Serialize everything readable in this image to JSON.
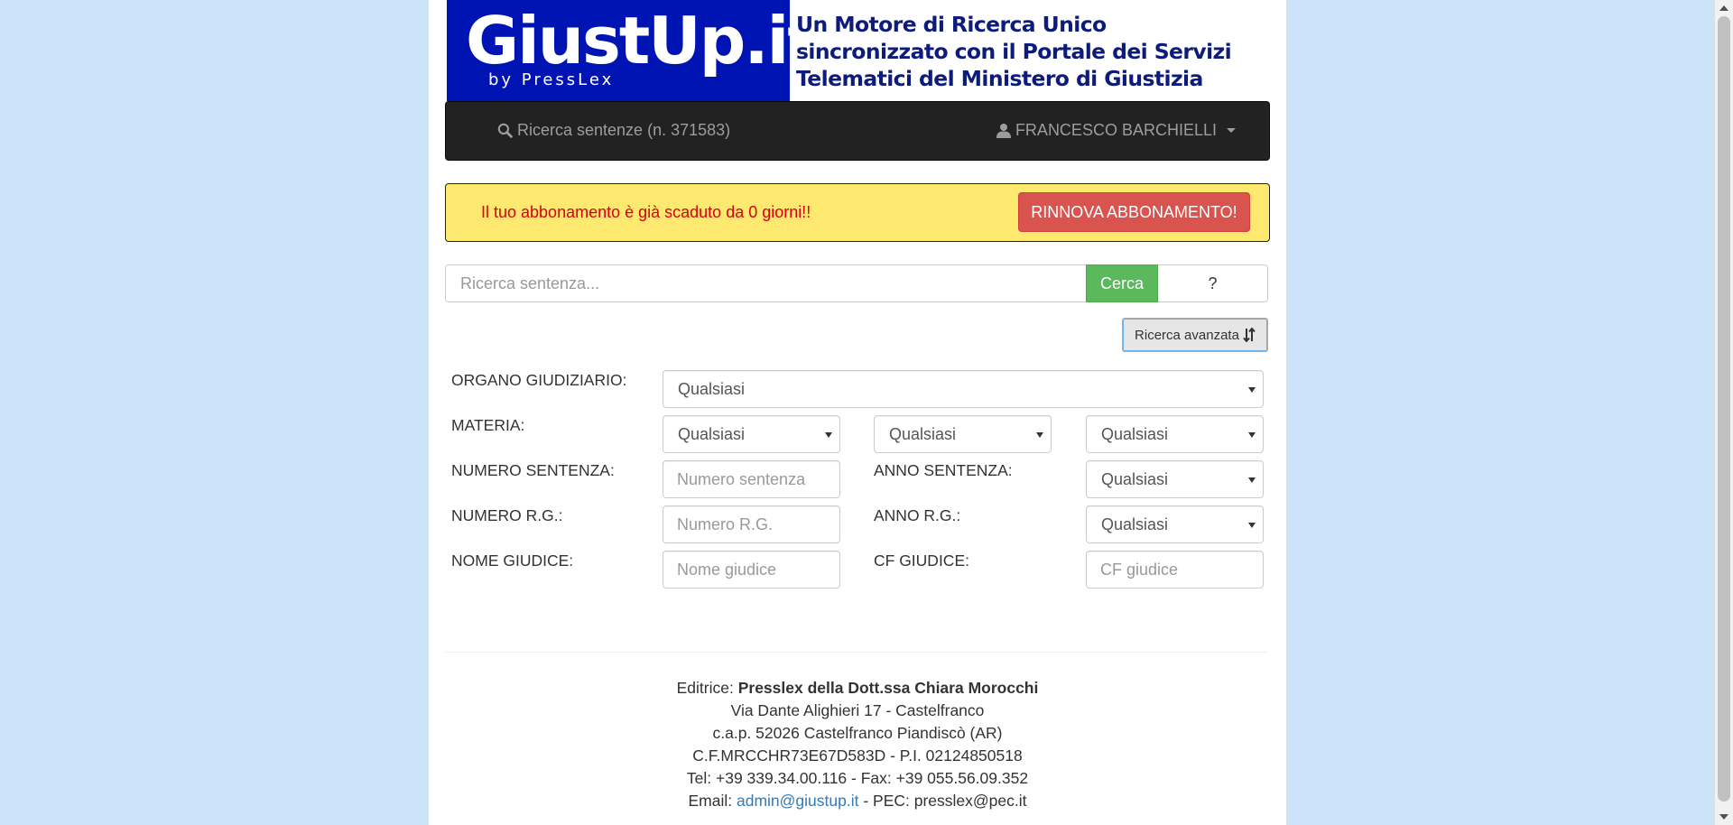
{
  "banner": {
    "logo_title": "GiustUp.it",
    "logo_sub": "by PressLex",
    "tagline": [
      "Un Motore di Ricerca Unico",
      "sincronizzato con il Portale dei Servizi",
      "Telematici del Ministero di Giustizia"
    ]
  },
  "navbar": {
    "search_label": "Ricerca sentenze (n. 371583)",
    "user_name": "FRANCESCO BARCHIELLI"
  },
  "alert": {
    "message": "Il tuo abbonamento è già scaduto da 0 giorni!!",
    "renew_button": "RINNOVA ABBONAMENTO!"
  },
  "search": {
    "placeholder": "Ricerca sentenza...",
    "submit_label": "Cerca",
    "help_label": "?"
  },
  "advanced": {
    "toggle_label": "Ricerca avanzata"
  },
  "form": {
    "organo_label": "ORGANO GIUDIZIARIO:",
    "organo_value": "Qualsiasi",
    "materia_label": "MATERIA:",
    "materia_values": [
      "Qualsiasi",
      "Qualsiasi",
      "Qualsiasi"
    ],
    "numero_sentenza_label": "NUMERO SENTENZA:",
    "numero_sentenza_placeholder": "Numero sentenza",
    "anno_sentenza_label": "ANNO SENTENZA:",
    "anno_sentenza_value": "Qualsiasi",
    "numero_rg_label": "NUMERO R.G.:",
    "numero_rg_placeholder": "Numero R.G.",
    "anno_rg_label": "ANNO R.G.:",
    "anno_rg_value": "Qualsiasi",
    "nome_giudice_label": "NOME GIUDICE:",
    "nome_giudice_placeholder": "Nome giudice",
    "cf_giudice_label": "CF GIUDICE:",
    "cf_giudice_placeholder": "CF giudice"
  },
  "footer": {
    "editrice_prefix": "Editrice:",
    "editrice_name": "Presslex della Dott.ssa Chiara Morocchi",
    "address": "Via Dante Alighieri 17 - Castelfranco",
    "cap": "c.a.p. 52026 Castelfranco Piandiscò (AR)",
    "cf_pi": "C.F.MRCCHR73E67D583D - P.I. 02124850518",
    "tel_fax": "Tel: +39 339.34.00.116 - Fax: +39 055.56.09.352",
    "email_prefix": "Email:",
    "email": "admin@giustup.it",
    "pec": "- PEC: presslex@pec.it"
  }
}
